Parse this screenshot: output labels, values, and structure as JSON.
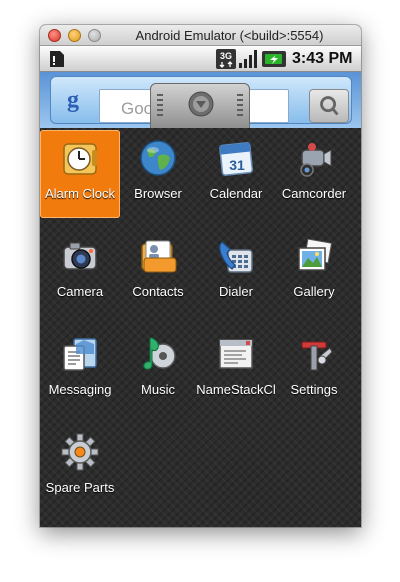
{
  "window": {
    "title": "Android Emulator (<build>:5554)"
  },
  "statusbar": {
    "network_label": "3G",
    "time": "3:43 PM"
  },
  "search_widget": {
    "logo": "g",
    "placeholder": "Goog"
  },
  "apps": [
    {
      "label": "Alarm Clock",
      "icon": "alarm-clock-icon",
      "selected": true
    },
    {
      "label": "Browser",
      "icon": "globe-icon",
      "selected": false
    },
    {
      "label": "Calendar",
      "icon": "calendar-icon",
      "day": "31",
      "selected": false
    },
    {
      "label": "Camcorder",
      "icon": "camcorder-icon",
      "selected": false
    },
    {
      "label": "Camera",
      "icon": "camera-icon",
      "selected": false
    },
    {
      "label": "Contacts",
      "icon": "contacts-icon",
      "selected": false
    },
    {
      "label": "Dialer",
      "icon": "phone-icon",
      "selected": false
    },
    {
      "label": "Gallery",
      "icon": "photos-icon",
      "selected": false
    },
    {
      "label": "Messaging",
      "icon": "messaging-icon",
      "selected": false
    },
    {
      "label": "Music",
      "icon": "music-icon",
      "selected": false
    },
    {
      "label": "NameStackCl",
      "icon": "window-app-icon",
      "selected": false
    },
    {
      "label": "Settings",
      "icon": "tools-icon",
      "selected": false
    },
    {
      "label": "Spare Parts",
      "icon": "gear-icon",
      "selected": false
    }
  ],
  "colors": {
    "selection": "#f27b0e",
    "drawer_bg": "#2c2c2c",
    "statusbar_bg": "#e6e6e6",
    "home_blue": "#5a93d6"
  }
}
